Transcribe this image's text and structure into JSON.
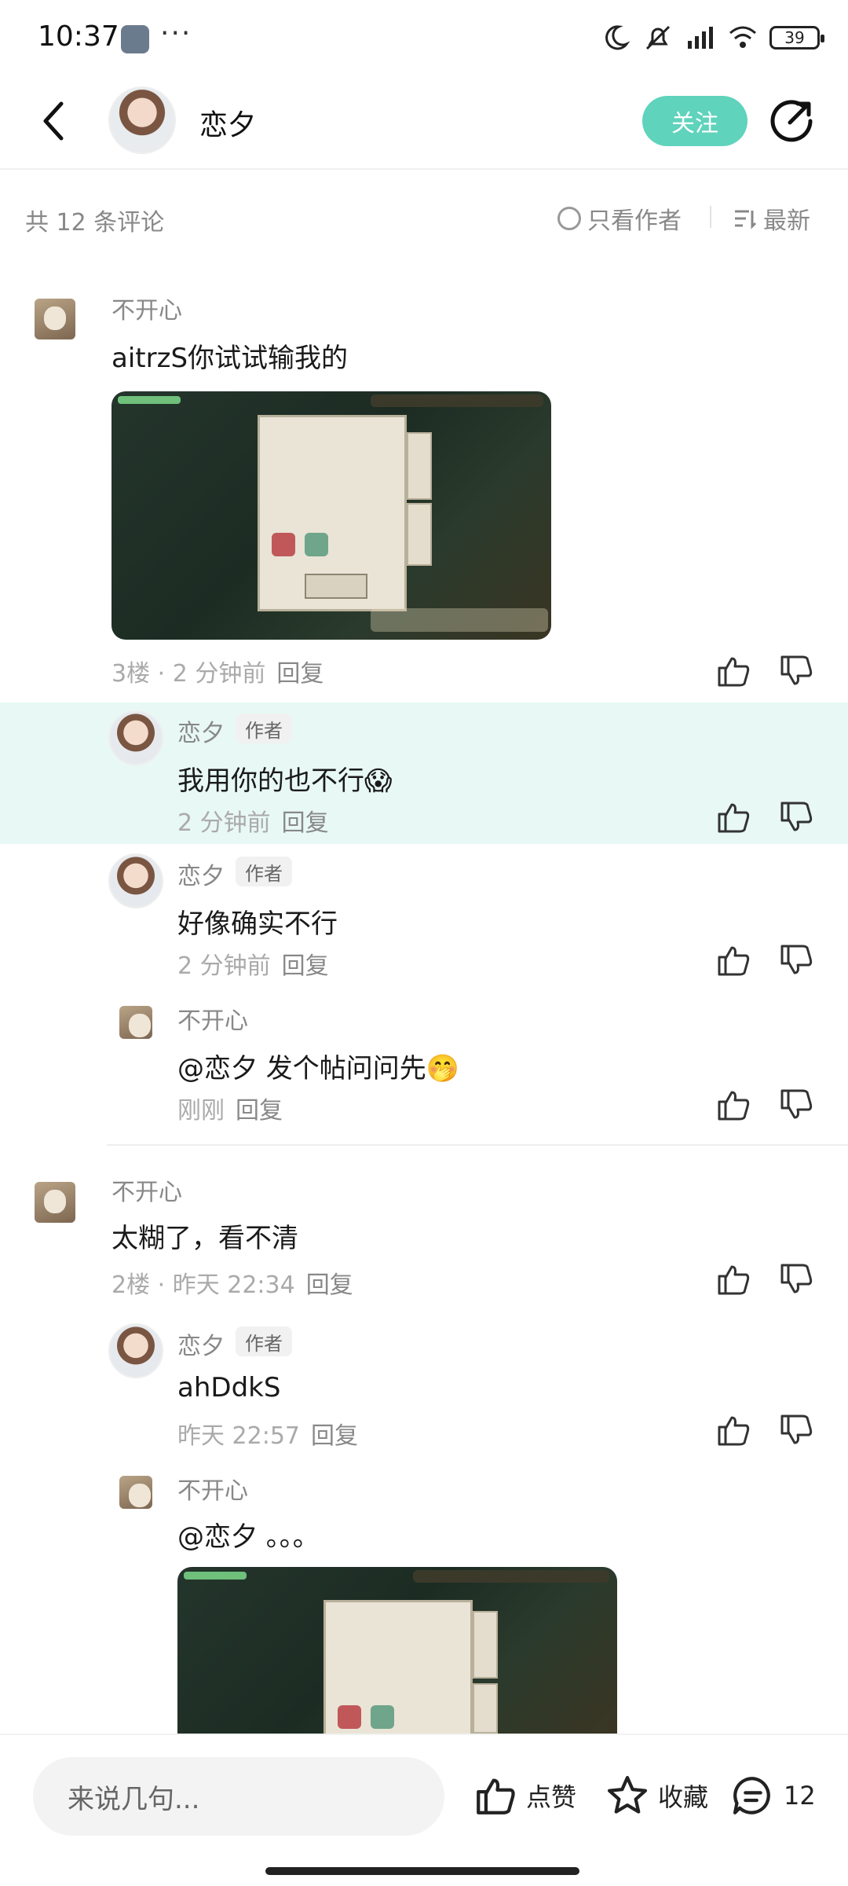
{
  "status_bar": {
    "time": "10:37",
    "dots": "···",
    "battery": "39"
  },
  "header": {
    "username": "恋夕",
    "follow_label": "关注"
  },
  "meta": {
    "count_label": "共 12 条评论",
    "only_author_label": "只看作者",
    "sort_label": "最新"
  },
  "comments": [
    {
      "user": "不开心",
      "text": "aitrzS你试试输我的",
      "footer": "3楼 · 2 分钟前",
      "reply_label": "回复",
      "replies": [
        {
          "user": "恋夕",
          "tag": "作者",
          "text": "我用你的也不行😱",
          "time": "2 分钟前",
          "reply_label": "回复"
        },
        {
          "user": "恋夕",
          "tag": "作者",
          "text": "好像确实不行",
          "time": "2 分钟前",
          "reply_label": "回复"
        },
        {
          "user": "不开心",
          "text": "@恋夕  发个帖问问先🤭",
          "time": "刚刚",
          "reply_label": "回复"
        }
      ]
    },
    {
      "user": "不开心",
      "text": "太糊了，看不清",
      "footer": "2楼 · 昨天 22:34",
      "reply_label": "回复",
      "replies": [
        {
          "user": "恋夕",
          "tag": "作者",
          "text": "ahDdkS",
          "time": "昨天 22:57",
          "reply_label": "回复"
        },
        {
          "user": "不开心",
          "text": "@恋夕  。。。"
        }
      ]
    }
  ],
  "bottom_bar": {
    "input_placeholder": "来说几句...",
    "like_label": "点赞",
    "favorite_label": "收藏",
    "comment_count": "12"
  },
  "colors": {
    "accent": "#5fd3bc",
    "highlight_bg": "#e8f8f4",
    "muted_text": "#aaaaaa"
  }
}
